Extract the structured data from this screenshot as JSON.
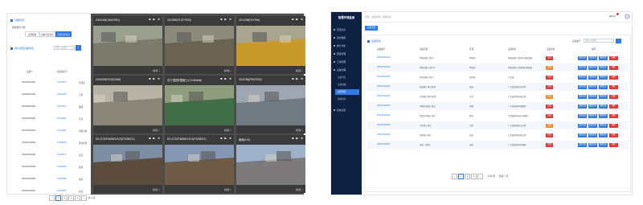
{
  "left": {
    "title": "远程管控",
    "filter_label": "视频展示分组",
    "seg_buttons": [
      "头部看板",
      "四看分屏显示",
      "大屏分屏显示"
    ],
    "list_title": "用户监控设备列表",
    "search_placeholder": "请输入设备编号",
    "table_headers": [
      "设备号",
      "视频监控号",
      ""
    ],
    "rows": [
      {
        "id": "202205010001",
        "code": "TF01RTS",
        "name": "滨河苑"
      },
      {
        "id": "202205010002",
        "code": "GS01RTS",
        "name": "万家"
      },
      {
        "id": "202205010003",
        "code": "TF01RTS",
        "name": "和园"
      },
      {
        "id": "202205120001",
        "code": "TF01ZKR",
        "name": "东升"
      },
      {
        "id": "202205120002",
        "code": "TF01ZKR",
        "name": "中建万科"
      },
      {
        "id": "202205120003",
        "code": "TF20MSS",
        "name": "西北片区"
      },
      {
        "id": "202205120004",
        "code": "TF01RTS",
        "name": "东区"
      },
      {
        "id": "202205120005",
        "code": "TF20MSS",
        "name": "高新"
      },
      {
        "id": "202205120006",
        "code": "TF20MSS",
        "name": "南苑"
      },
      {
        "id": "202205120007",
        "code": "TF01RTS",
        "name": "北苑"
      }
    ],
    "pager": {
      "pages": [
        "1",
        "2",
        "3",
        "4"
      ],
      "active": "1",
      "total": "共 8 页"
    },
    "cameras": [
      {
        "title": "2204100(C440G931)",
        "foot": "标清 ⛶"
      },
      {
        "title": "2102550(TL5TY0G4)",
        "foot": "标清 ⛶"
      },
      {
        "title": "2101338(F3X7N4)",
        "foot": "标清 ⛶"
      },
      {
        "title": "2104030(F0GQV4A8)",
        "foot": "标清 ⛶"
      },
      {
        "title": "东门花园外围施工(C7L5N4A8)",
        "foot": "标清 ⛶"
      },
      {
        "title": "2103780(F90GT0N)",
        "foot": "标清 ⛶"
      },
      {
        "title": "DS-2CD3T46WDV3-I3(F3238221)",
        "foot": "标清 ⛶"
      },
      {
        "title": "DS-2CD3T46WDV3-I3(F3238221)",
        "foot": "标清 ⛶"
      },
      {
        "title": "南侧(K13)",
        "foot": "标清 ⛶"
      }
    ],
    "cam_icons": "◙ ▶ ⊕",
    "colors": {
      "accent": "#2f7ae5",
      "wall": "#4d4d4d"
    }
  },
  "right": {
    "system_name": "智慧环境监测",
    "menu": [
      {
        "label": "首页总览"
      },
      {
        "label": "实时数据"
      },
      {
        "label": "统计分析"
      },
      {
        "label": "预警管理"
      },
      {
        "label": "工地管理"
      },
      {
        "label": "设备管理"
      }
    ],
    "submenu": [
      {
        "label": "设备列表",
        "active": false
      },
      {
        "label": "设备地图",
        "active": false
      },
      {
        "label": "远程管控",
        "active": true
      },
      {
        "label": "视频监控",
        "active": false
      }
    ],
    "menu_after": [
      {
        "label": "系统设置"
      }
    ],
    "breadcrumb": "首页 / 设备管理 / 远程管控",
    "user": "admin",
    "tag": "远程管控",
    "section_title": "设备列表",
    "search_label": "设备编号",
    "search_placeholder": "请输入设备编号",
    "search_button": "⌕",
    "headers": [
      "设备编号",
      "设备名称",
      "区域",
      "设备地址",
      "设备状态",
      "操作"
    ],
    "rows": [
      {
        "id": "202205010001",
        "name": "明珠苑施工扬尘",
        "area": "明珠苑",
        "addr": "明珠苑施工现场东南角设备",
        "status": "在线"
      },
      {
        "id": "202205010002",
        "name": "明珠苑施工扬尘2",
        "area": "明珠苑",
        "addr": "明珠苑施工现场西北角设备",
        "status": "离线"
      },
      {
        "id": "202205010003",
        "name": "滨河苑施工扬尘",
        "area": "滨河苑",
        "addr": "广东省",
        "status": "在线"
      },
      {
        "id": "202205120001",
        "name": "和园施工扬尘监测",
        "area": "和园",
        "addr": "广东省深圳市龙岗区",
        "status": "在线"
      },
      {
        "id": "202205120002",
        "name": "东升施工扬尘监测",
        "area": "东升",
        "addr": "广东省深圳市南山区",
        "status": "离线"
      },
      {
        "id": "202205120003",
        "name": "中建万科施工扬尘",
        "area": "中建",
        "addr": "广东省深圳市福田区",
        "status": "在线"
      },
      {
        "id": "202205120004",
        "name": "西北片区施工扬尘",
        "area": "西北",
        "addr": "江西省南昌市红谷滩区",
        "status": "在线"
      },
      {
        "id": "202205120005",
        "name": "东区施工扬尘",
        "area": "东区",
        "addr": "广东省深圳市宝安区",
        "status": "离线"
      },
      {
        "id": "202205120006",
        "name": "高新施工扬尘",
        "area": "高新",
        "addr": "广东省深圳市南山区",
        "status": "在线"
      },
      {
        "id": "202205120007",
        "name": "南苑（测试）",
        "area": "南苑",
        "addr": "广东省深圳市罗湖区",
        "status": "在线"
      }
    ],
    "ops": [
      "远程控制",
      "数据查询",
      "视频监控",
      "删除"
    ],
    "pager": {
      "prev": "‹",
      "pages": [
        "1",
        "2",
        "3"
      ],
      "active": "1",
      "next": "›",
      "size": "10条/页",
      "jump": "前往 1 页"
    },
    "colors": {
      "sidebar": "#0e2142",
      "accent": "#2f7ae5",
      "online": "#e2393a",
      "op_blue": "#2f7ae5",
      "op_red": "#e2393a"
    }
  }
}
